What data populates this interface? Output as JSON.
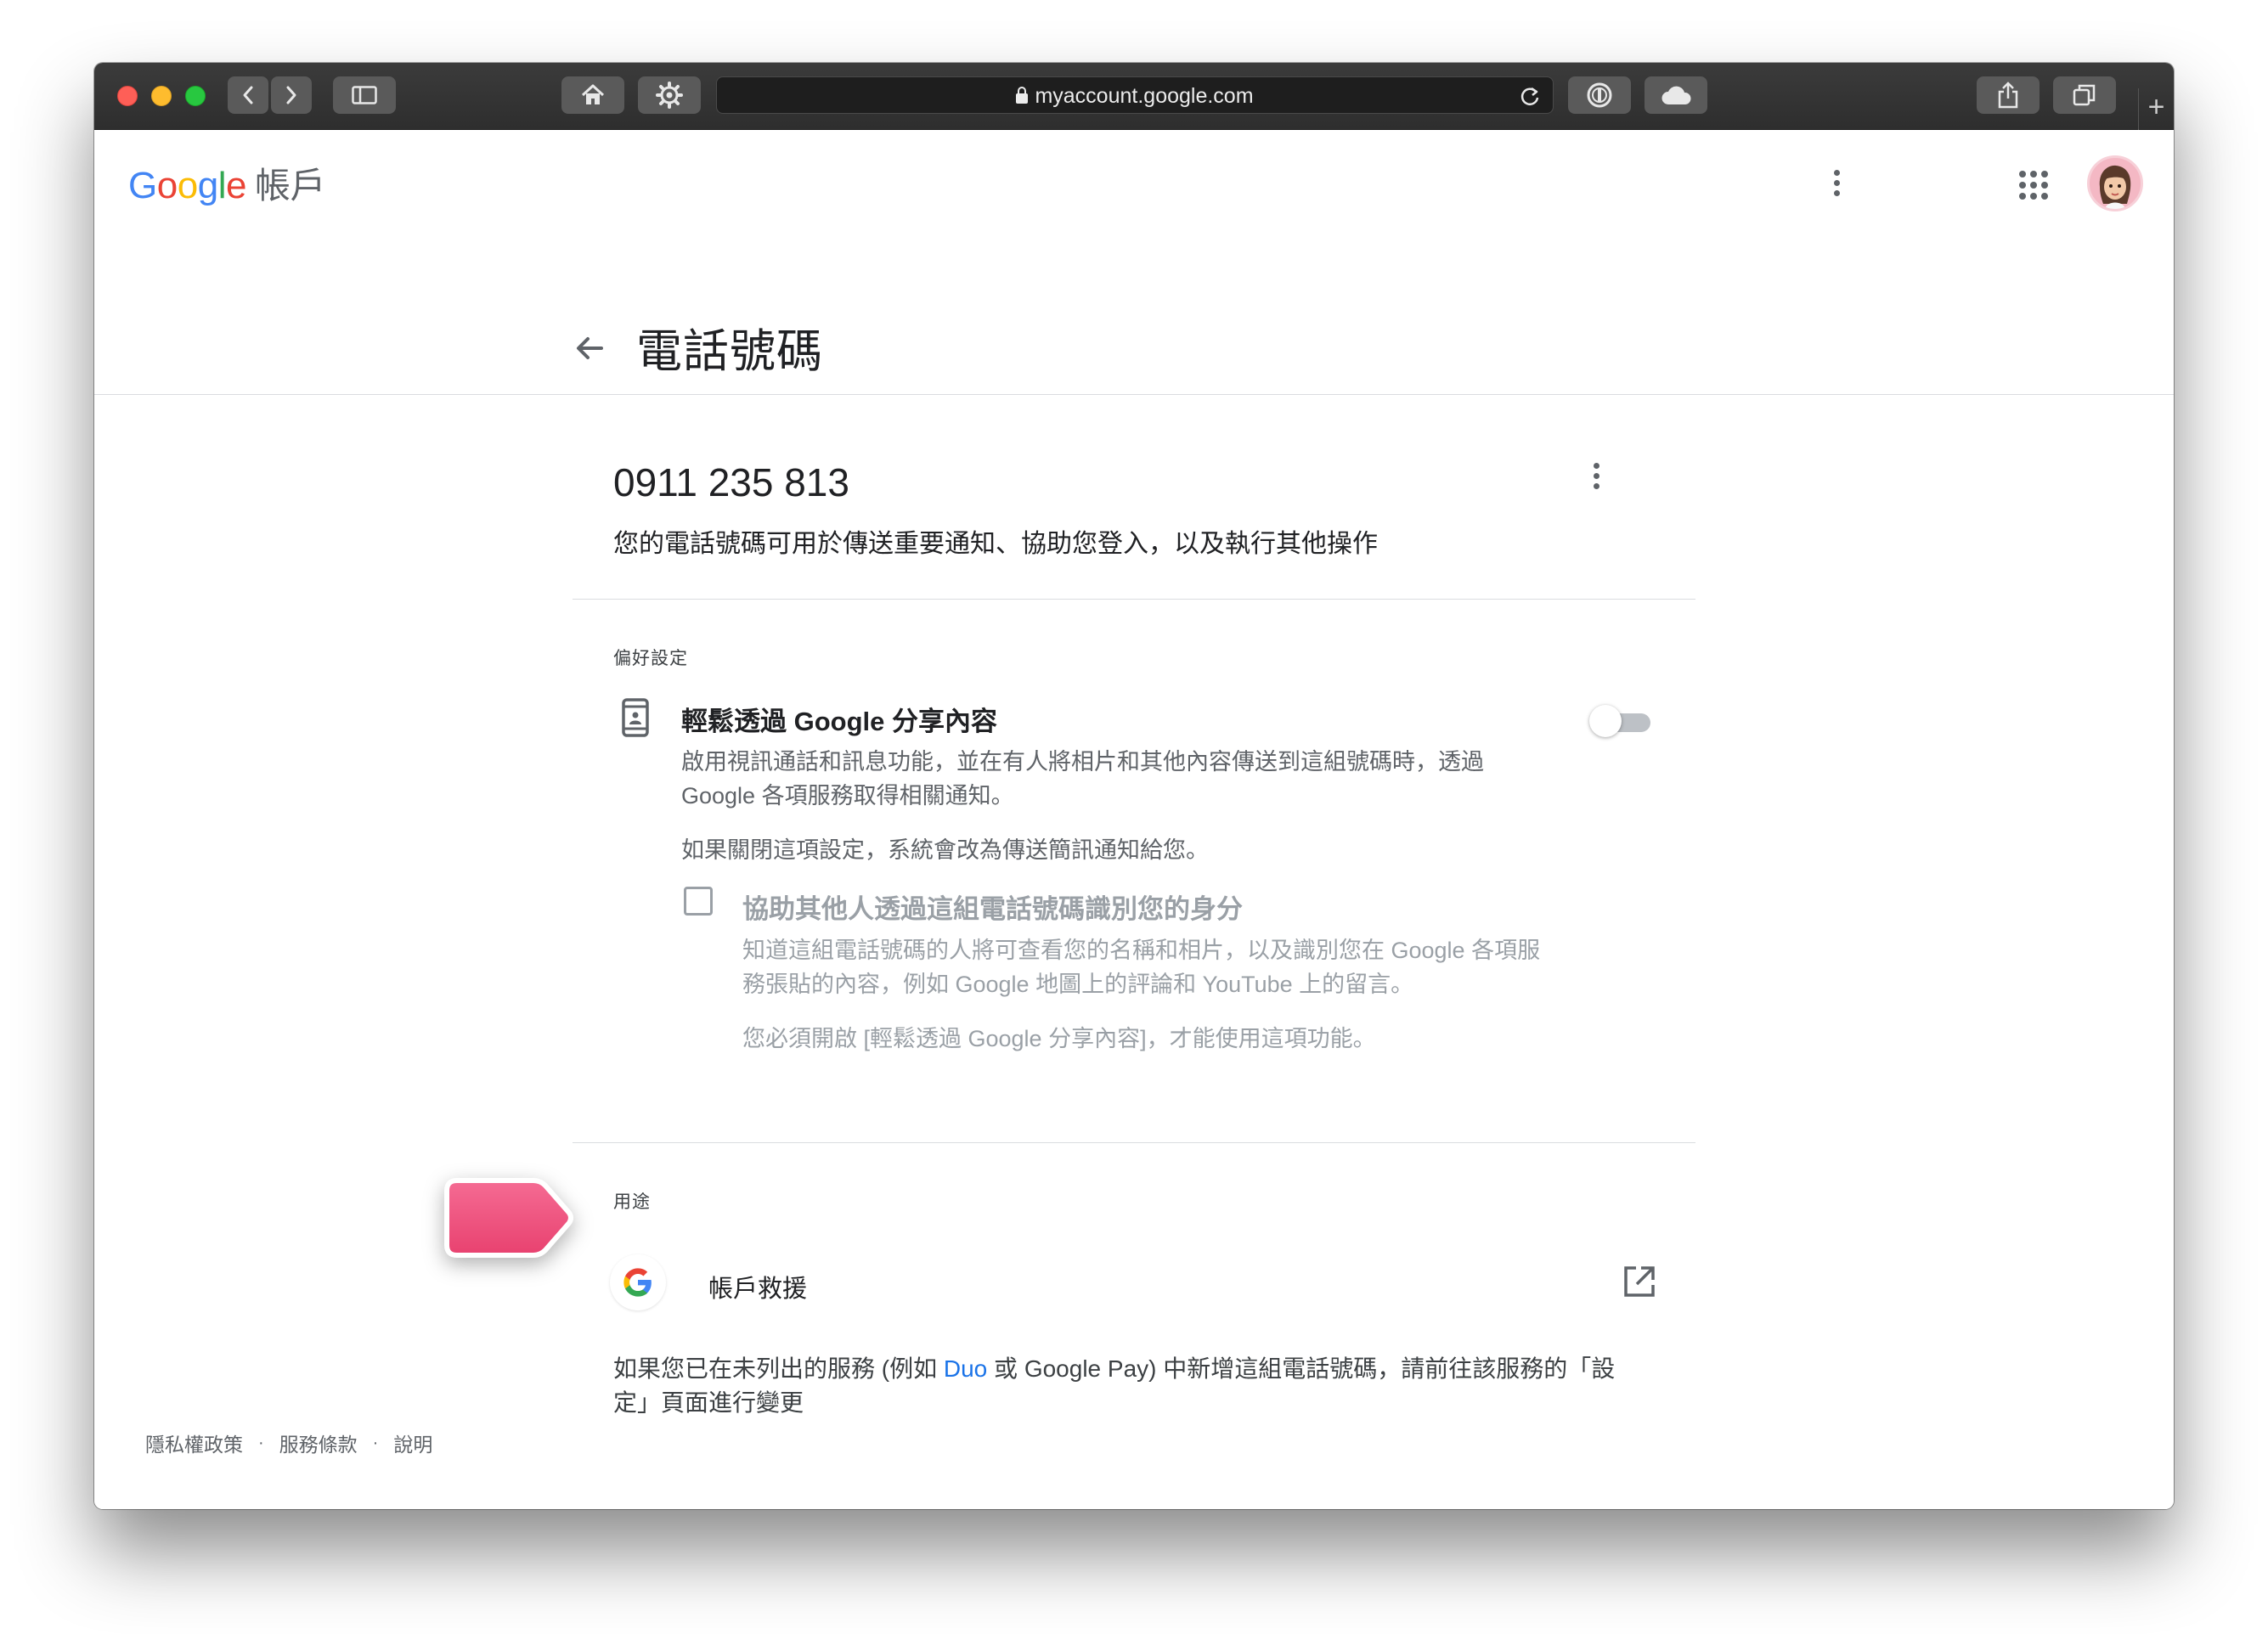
{
  "browser": {
    "url": "myaccount.google.com"
  },
  "header": {
    "logo_letters": [
      "G",
      "o",
      "o",
      "g",
      "l",
      "e"
    ],
    "logo_suffix": "帳戶",
    "page_title": "電話號碼"
  },
  "phone": {
    "number": "0911 235 813",
    "description": "您的電話號碼可用於傳送重要通知、協助您登入，以及執行其他操作"
  },
  "preferences": {
    "section_label": "偏好設定",
    "setting_title": "輕鬆透過 Google 分享內容",
    "setting_desc_line1": "啟用視訊通話和訊息功能，並在有人將相片和其他內容傳送到這組號碼時，透過",
    "setting_desc_line2": "Google 各項服務取得相關通知。",
    "setting_note": "如果關閉這項設定，系統會改為傳送簡訊通知給您。",
    "toggle_on": false,
    "checkbox_checked": false,
    "checkbox_title": "協助其他人透過這組電話號碼識別您的身分",
    "checkbox_desc_line1": "知道這組電話號碼的人將可查看您的名稱和相片，以及識別您在 Google 各項服",
    "checkbox_desc_line2": "務張貼的內容，例如 Google 地圖上的評論和 YouTube 上的留言。",
    "checkbox_note": "您必須開啟 [輕鬆透過 Google 分享內容]，才能使用這項功能。"
  },
  "usage": {
    "section_label": "用途",
    "item_label": "帳戶救援",
    "note_part1": "如果您已在未列出的服務 (例如 ",
    "note_link": "Duo",
    "note_part2": " 或 Google Pay) 中新增這組電話號碼，請前往該服務的「設",
    "note_line2": "定」頁面進行變更"
  },
  "footer": {
    "privacy": "隱私權政策",
    "terms": "服務條款",
    "help": "說明",
    "separator": "·"
  },
  "colors": {
    "google_blue": "#4285f4",
    "google_red": "#ea4335",
    "google_yellow": "#fbbc05",
    "google_green": "#34a853",
    "link": "#1a73e8",
    "tag_pink": "#ee4a78"
  }
}
